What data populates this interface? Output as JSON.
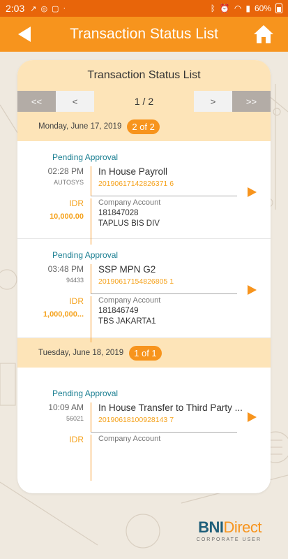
{
  "statusbar": {
    "time": "2:03",
    "battery": "60%"
  },
  "header": {
    "title": "Transaction Status List"
  },
  "card": {
    "title": "Transaction Status List"
  },
  "pager": {
    "first": "<<",
    "prev": "<",
    "page": "1 / 2",
    "next": ">",
    "last": ">>"
  },
  "groups": [
    {
      "date": "Monday, June 17, 2019",
      "badge": "2 of 2",
      "items": [
        {
          "status": "Pending Approval",
          "time": "02:28 PM",
          "user": "AUTOSYS",
          "name": "In House Payroll",
          "ref": "20190617142826371 6",
          "currency": "IDR",
          "amount": "10,000.00",
          "account_label": "Company Account",
          "account_no": "181847028",
          "account_name": "TAPLUS BIS DIV"
        },
        {
          "status": "Pending Approval",
          "time": "03:48 PM",
          "user": "94433",
          "name": "SSP MPN G2",
          "ref": "20190617154826805 1",
          "currency": "IDR",
          "amount": "1,000,000...",
          "account_label": "Company Account",
          "account_no": "181846749",
          "account_name": "TBS JAKARTA1"
        }
      ]
    },
    {
      "date": "Tuesday, June 18, 2019",
      "badge": "1 of 1",
      "items": [
        {
          "status": "Pending Approval",
          "time": "10:09 AM",
          "user": "56021",
          "name": "In House Transfer to Third Party ...",
          "ref": "20190618100928143 7",
          "currency": "IDR",
          "amount": "",
          "account_label": "Company Account",
          "account_no": "",
          "account_name": ""
        }
      ]
    }
  ],
  "brand": {
    "logo_a": "BNI",
    "logo_b": "Direct",
    "sub": "CORPORATE USER"
  },
  "colors": {
    "accent": "#f7941d",
    "statusbar": "#e8650a",
    "teal": "#1b7f92",
    "band": "#fde4b8"
  }
}
